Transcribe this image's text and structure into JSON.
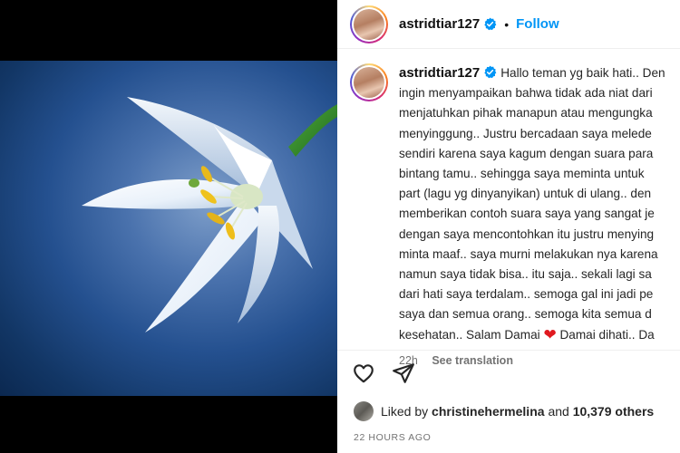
{
  "header": {
    "username": "astridtiar127",
    "separator": "•",
    "follow_label": "Follow"
  },
  "caption": {
    "username": "astridtiar127",
    "lines": [
      "Hallo teman yg baik hati.. Den",
      "ingin menyampaikan bahwa tidak ada niat dari",
      "menjatuhkan pihak manapun atau mengungka",
      "menyinggung.. Justru bercadaan saya melede",
      "sendiri karena saya kagum dengan suara para",
      "bintang tamu.. sehingga saya meminta untuk",
      "part (lagu yg dinyanyikan) untuk di ulang.. den",
      "memberikan contoh suara saya yang sangat je",
      "dengan saya mencontohkan itu justru menying",
      "minta maaf.. saya murni melakukan nya karena",
      "namun saya tidak bisa.. itu saja.. sekali lagi sa",
      "dari hati saya terdalam.. semoga gal ini jadi pe",
      "saya dan semua orang.. semoga kita semua d"
    ],
    "last_line_before": "kesehatan.. Salam Damai",
    "last_line_after": "Damai dihati.. Da",
    "age": "22h",
    "see_translation": "See translation"
  },
  "actions": {
    "like_icon": "heart-outline-icon",
    "share_icon": "paper-plane-icon"
  },
  "likes": {
    "prefix": "Liked by",
    "user": "christinehermelina",
    "and": "and",
    "others": "10,379 others"
  },
  "timestamp": "22 HOURS AGO",
  "colors": {
    "follow": "#0095f6",
    "verified": "#0095f6",
    "heart_emoji": "#e0191f"
  }
}
